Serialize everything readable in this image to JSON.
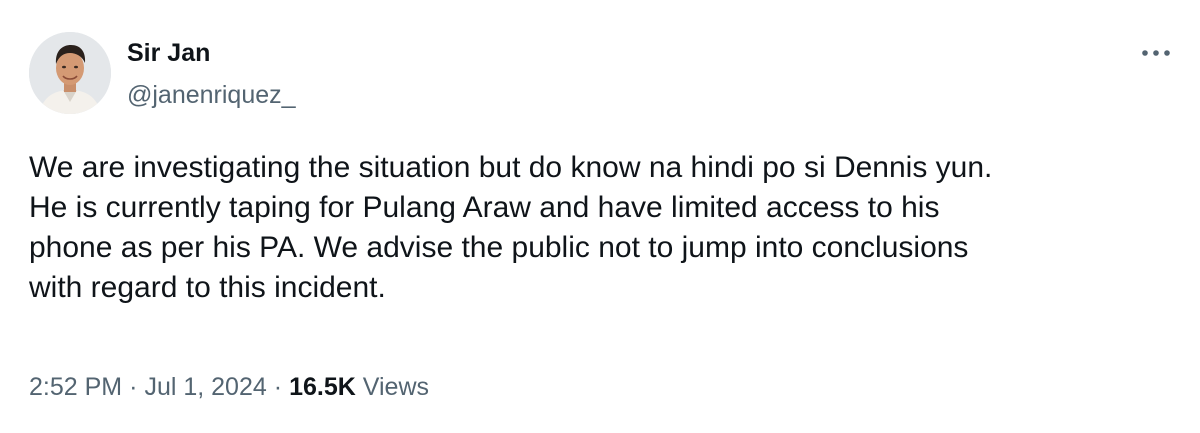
{
  "author": {
    "name": "Sir Jan",
    "handle": "@janenriquez_"
  },
  "more_icon": "more-horizontal-icon",
  "tweet": {
    "text": "We are investigating the situation but do know na hindi po si Dennis yun.\nHe is currently taping for Pulang Araw and have limited access to his\nphone as per his PA. We advise the public not to jump into conclusions\nwith regard to this incident."
  },
  "meta": {
    "time": "2:52 PM",
    "separator": "·",
    "date": "Jul 1, 2024",
    "views_count": "16.5K",
    "views_label": "Views"
  },
  "colors": {
    "text_primary": "#0f1419",
    "text_secondary": "#536471",
    "background": "#ffffff"
  }
}
